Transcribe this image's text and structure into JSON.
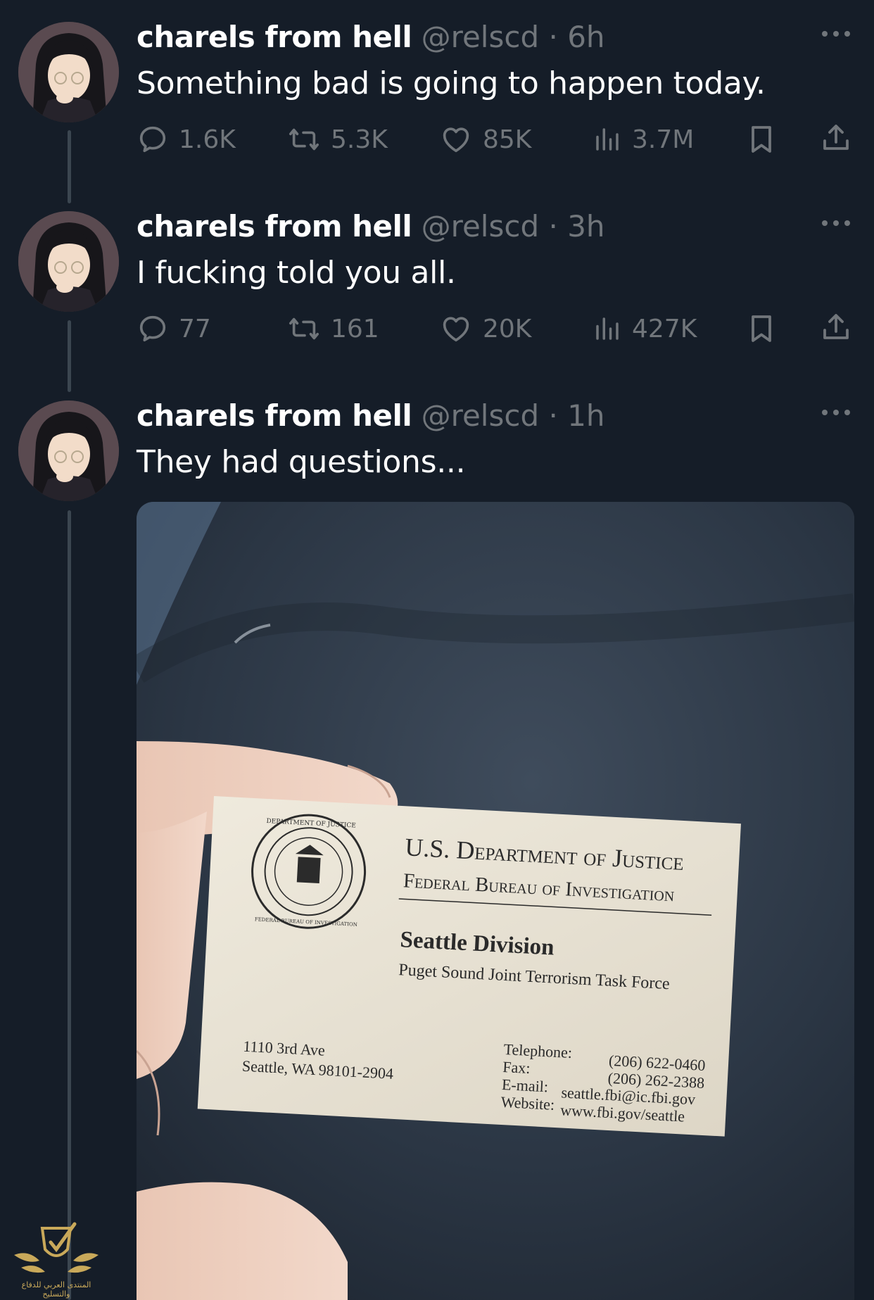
{
  "tweets": [
    {
      "name": "charels from hell",
      "handle": "@relscd",
      "time": "6h",
      "text": "Something bad is going to happen today.",
      "replies": "1.6K",
      "reposts": "5.3K",
      "likes": "85K",
      "views": "3.7M"
    },
    {
      "name": "charels from hell",
      "handle": "@relscd",
      "time": "3h",
      "text": "I fucking told you all.",
      "replies": "77",
      "reposts": "161",
      "likes": "20K",
      "views": "427K"
    },
    {
      "name": "charels from hell",
      "handle": "@relscd",
      "time": "1h",
      "text": "They had questions..."
    }
  ],
  "card": {
    "line1": "U.S. Department of Justice",
    "line2": "Federal Bureau of Investigation",
    "division": "Seattle Division",
    "task_force": "Puget Sound Joint Terrorism Task Force",
    "address1": "1110 3rd Ave",
    "address2": "Seattle, WA 98101-2904",
    "tel_label": "Telephone:",
    "fax_label": "Fax:",
    "email_label": "E-mail:",
    "web_label": "Website:",
    "tel": "(206) 622-0460",
    "fax": "(206) 262-2388",
    "email": "seattle.fbi@ic.fbi.gov",
    "web": "www.fbi.gov/seattle",
    "seal_top": "DEPARTMENT OF JUSTICE",
    "seal_bottom": "FEDERAL BUREAU OF INVESTIGATION"
  },
  "watermark": {
    "text": "المنتدى العربي للدفاع والتسليح"
  },
  "colors": {
    "background": "#151d28",
    "text": "#e7e9ea",
    "muted": "#71767b",
    "thread_line": "#3b4650"
  }
}
